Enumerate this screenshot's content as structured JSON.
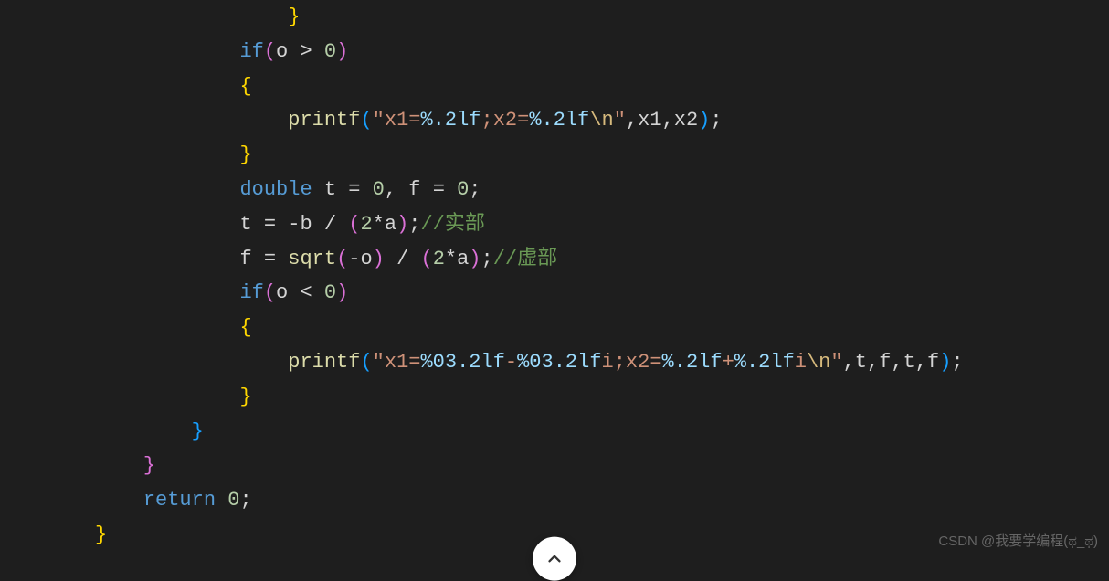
{
  "code": {
    "lines": [
      {
        "indent": 4,
        "tokens": [
          {
            "t": "brace",
            "v": "}"
          }
        ]
      },
      {
        "indent": 3,
        "tokens": [
          {
            "t": "kw",
            "v": "if"
          },
          {
            "t": "paren2",
            "v": "("
          },
          {
            "t": "ident",
            "v": "o "
          },
          {
            "t": "op",
            "v": "> "
          },
          {
            "t": "num",
            "v": "0"
          },
          {
            "t": "paren2",
            "v": ")"
          }
        ]
      },
      {
        "indent": 3,
        "tokens": [
          {
            "t": "brace",
            "v": "{"
          }
        ]
      },
      {
        "indent": 4,
        "tokens": [
          {
            "t": "fn",
            "v": "printf"
          },
          {
            "t": "paren3",
            "v": "("
          },
          {
            "t": "str",
            "v": "\"x1="
          },
          {
            "t": "fmt",
            "v": "%.2lf"
          },
          {
            "t": "str",
            "v": ";x2="
          },
          {
            "t": "fmt",
            "v": "%.2lf"
          },
          {
            "t": "esc",
            "v": "\\n"
          },
          {
            "t": "str",
            "v": "\""
          },
          {
            "t": "ident",
            "v": ",x1,x2"
          },
          {
            "t": "paren3",
            "v": ")"
          },
          {
            "t": "ident",
            "v": ";"
          }
        ]
      },
      {
        "indent": 3,
        "tokens": [
          {
            "t": "brace",
            "v": "}"
          }
        ]
      },
      {
        "indent": 3,
        "tokens": [
          {
            "t": "type",
            "v": "double"
          },
          {
            "t": "ident",
            "v": " t "
          },
          {
            "t": "op",
            "v": "= "
          },
          {
            "t": "num",
            "v": "0"
          },
          {
            "t": "ident",
            "v": ", f "
          },
          {
            "t": "op",
            "v": "= "
          },
          {
            "t": "num",
            "v": "0"
          },
          {
            "t": "ident",
            "v": ";"
          }
        ]
      },
      {
        "indent": 3,
        "tokens": [
          {
            "t": "ident",
            "v": "t "
          },
          {
            "t": "op",
            "v": "= -"
          },
          {
            "t": "ident",
            "v": "b "
          },
          {
            "t": "op",
            "v": "/ "
          },
          {
            "t": "paren2",
            "v": "("
          },
          {
            "t": "num",
            "v": "2"
          },
          {
            "t": "op",
            "v": "*"
          },
          {
            "t": "ident",
            "v": "a"
          },
          {
            "t": "paren2",
            "v": ")"
          },
          {
            "t": "ident",
            "v": ";"
          },
          {
            "t": "comment",
            "v": "//实部"
          }
        ]
      },
      {
        "indent": 3,
        "tokens": [
          {
            "t": "ident",
            "v": "f "
          },
          {
            "t": "op",
            "v": "= "
          },
          {
            "t": "fn",
            "v": "sqrt"
          },
          {
            "t": "paren2",
            "v": "("
          },
          {
            "t": "op",
            "v": "-"
          },
          {
            "t": "ident",
            "v": "o"
          },
          {
            "t": "paren2",
            "v": ")"
          },
          {
            "t": "op",
            "v": " / "
          },
          {
            "t": "paren2",
            "v": "("
          },
          {
            "t": "num",
            "v": "2"
          },
          {
            "t": "op",
            "v": "*"
          },
          {
            "t": "ident",
            "v": "a"
          },
          {
            "t": "paren2",
            "v": ")"
          },
          {
            "t": "ident",
            "v": ";"
          },
          {
            "t": "comment",
            "v": "//虚部"
          }
        ]
      },
      {
        "indent": 3,
        "tokens": [
          {
            "t": "kw",
            "v": "if"
          },
          {
            "t": "paren2",
            "v": "("
          },
          {
            "t": "ident",
            "v": "o "
          },
          {
            "t": "op",
            "v": "< "
          },
          {
            "t": "num",
            "v": "0"
          },
          {
            "t": "paren2",
            "v": ")"
          }
        ]
      },
      {
        "indent": 3,
        "tokens": [
          {
            "t": "brace",
            "v": "{"
          }
        ]
      },
      {
        "indent": 4,
        "tokens": [
          {
            "t": "fn",
            "v": "printf"
          },
          {
            "t": "paren3",
            "v": "("
          },
          {
            "t": "str",
            "v": "\"x1="
          },
          {
            "t": "fmt",
            "v": "%03.2lf"
          },
          {
            "t": "str",
            "v": "-"
          },
          {
            "t": "fmt",
            "v": "%03.2lf"
          },
          {
            "t": "str",
            "v": "i;x2="
          },
          {
            "t": "fmt",
            "v": "%.2lf"
          },
          {
            "t": "str",
            "v": "+"
          },
          {
            "t": "fmt",
            "v": "%.2lf"
          },
          {
            "t": "str",
            "v": "i"
          },
          {
            "t": "esc",
            "v": "\\n"
          },
          {
            "t": "str",
            "v": "\""
          },
          {
            "t": "ident",
            "v": ",t,f,t,f"
          },
          {
            "t": "paren3",
            "v": ")"
          },
          {
            "t": "ident",
            "v": ";"
          }
        ]
      },
      {
        "indent": 3,
        "tokens": [
          {
            "t": "brace",
            "v": "}"
          }
        ]
      },
      {
        "indent": 2,
        "tokens": [
          {
            "t": "brace3",
            "v": "}"
          }
        ]
      },
      {
        "indent": 1,
        "tokens": [
          {
            "t": "brace2",
            "v": "}"
          }
        ]
      },
      {
        "indent": 1,
        "tokens": [
          {
            "t": "kw",
            "v": "return"
          },
          {
            "t": "ident",
            "v": " "
          },
          {
            "t": "num",
            "v": "0"
          },
          {
            "t": "ident",
            "v": ";"
          }
        ]
      },
      {
        "indent": 0,
        "tokens": [
          {
            "t": "brace",
            "v": "}"
          }
        ]
      }
    ]
  },
  "watermark": "CSDN @我要学编程(ಥ_ಥ)",
  "indent_unit": "    "
}
